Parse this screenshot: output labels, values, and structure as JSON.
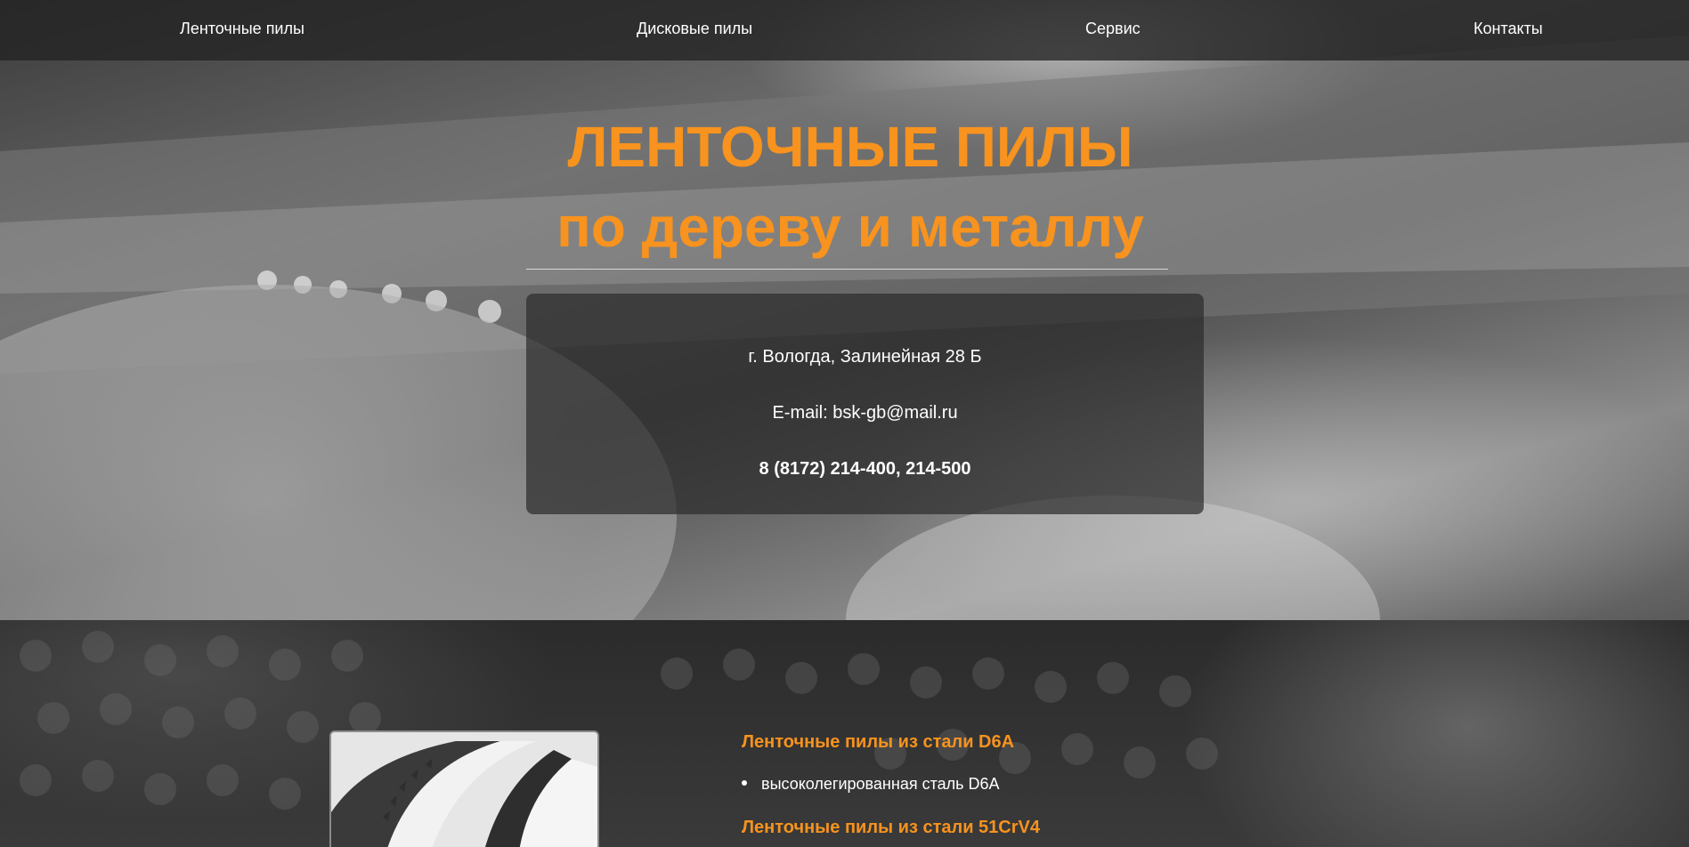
{
  "nav": {
    "items": [
      {
        "label": "Ленточные пилы"
      },
      {
        "label": "Дисковые пилы"
      },
      {
        "label": "Сервис"
      },
      {
        "label": "Контакты"
      }
    ]
  },
  "hero": {
    "title_line1": "ЛЕНТОЧНЫЕ ПИЛЫ",
    "title_line2": "по дереву и металлу",
    "contact": {
      "address": "г. Вологда, Залинейная 28 Б",
      "email": "E-mail: bsk-gb@mail.ru",
      "phone": "8 (8172) 214-400, 214-500"
    }
  },
  "products": {
    "items": [
      {
        "heading": "Ленточные пилы из стали D6A",
        "bullets": [
          "высоколегированная сталь D6A"
        ]
      },
      {
        "heading": "Ленточные пилы из стали 51CrV4",
        "bullets": []
      }
    ]
  },
  "colors": {
    "accent": "#f7931e",
    "nav_bg": "#232323",
    "text": "#ffffff"
  }
}
